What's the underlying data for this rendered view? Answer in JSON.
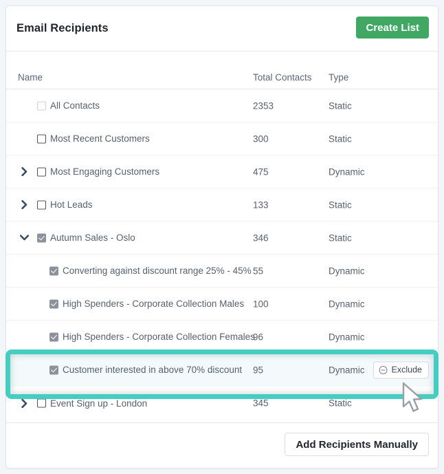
{
  "panel": {
    "title": "Email Recipients",
    "create_list_label": "Create List",
    "add_manually_label": "Add Recipients Manually"
  },
  "table": {
    "columns": {
      "name": "Name",
      "total_contacts": "Total Contacts",
      "type": "Type"
    },
    "rows": [
      {
        "name": "All Contacts",
        "total_contacts": "2353",
        "type": "Static",
        "level": 0,
        "checkbox": "muted",
        "chevron": "none",
        "highlighted": false,
        "action": null
      },
      {
        "name": "Most Recent Customers",
        "total_contacts": "300",
        "type": "Static",
        "level": 0,
        "checkbox": "unchecked",
        "chevron": "none",
        "highlighted": false,
        "action": null
      },
      {
        "name": "Most Engaging Customers",
        "total_contacts": "475",
        "type": "Dynamic",
        "level": 0,
        "checkbox": "unchecked",
        "chevron": "collapsed",
        "highlighted": false,
        "action": null
      },
      {
        "name": "Hot Leads",
        "total_contacts": "133",
        "type": "Static",
        "level": 0,
        "checkbox": "unchecked",
        "chevron": "collapsed",
        "highlighted": false,
        "action": null
      },
      {
        "name": "Autumn Sales - Oslo",
        "total_contacts": "346",
        "type": "Static",
        "level": 0,
        "checkbox": "checked",
        "chevron": "expanded",
        "highlighted": false,
        "action": null
      },
      {
        "name": "Converting against discount range 25% - 45%",
        "total_contacts": "55",
        "type": "Dynamic",
        "level": 1,
        "checkbox": "checked",
        "chevron": "none",
        "highlighted": false,
        "action": null
      },
      {
        "name": "High Spenders - Corporate Collection Males",
        "total_contacts": "100",
        "type": "Dynamic",
        "level": 1,
        "checkbox": "checked",
        "chevron": "none",
        "highlighted": false,
        "action": null
      },
      {
        "name": "High Spenders - Corporate Collection Females",
        "total_contacts": "96",
        "type": "Dynamic",
        "level": 1,
        "checkbox": "checked",
        "chevron": "none",
        "highlighted": false,
        "action": null
      },
      {
        "name": "Customer interested in above 70% discount",
        "total_contacts": "95",
        "type": "Dynamic",
        "level": 1,
        "checkbox": "checked",
        "chevron": "none",
        "highlighted": true,
        "action": "Exclude"
      },
      {
        "name": "Event Sign up - London",
        "total_contacts": "345",
        "type": "Static",
        "level": 0,
        "checkbox": "unchecked",
        "chevron": "collapsed",
        "highlighted": false,
        "action": null
      }
    ]
  },
  "colors": {
    "accent_green": "#41a863",
    "highlight_teal": "#46cdc1",
    "text_primary": "#22262b",
    "text_secondary": "#56606f",
    "panel_border": "#dfe3e8",
    "page_background": "#f3f6f9"
  },
  "icons": {
    "chevron_collapsed": "chevron-right-icon",
    "chevron_expanded": "chevron-down-icon",
    "exclude": "minus-circle-icon",
    "cursor": "cursor-pointer-icon"
  }
}
